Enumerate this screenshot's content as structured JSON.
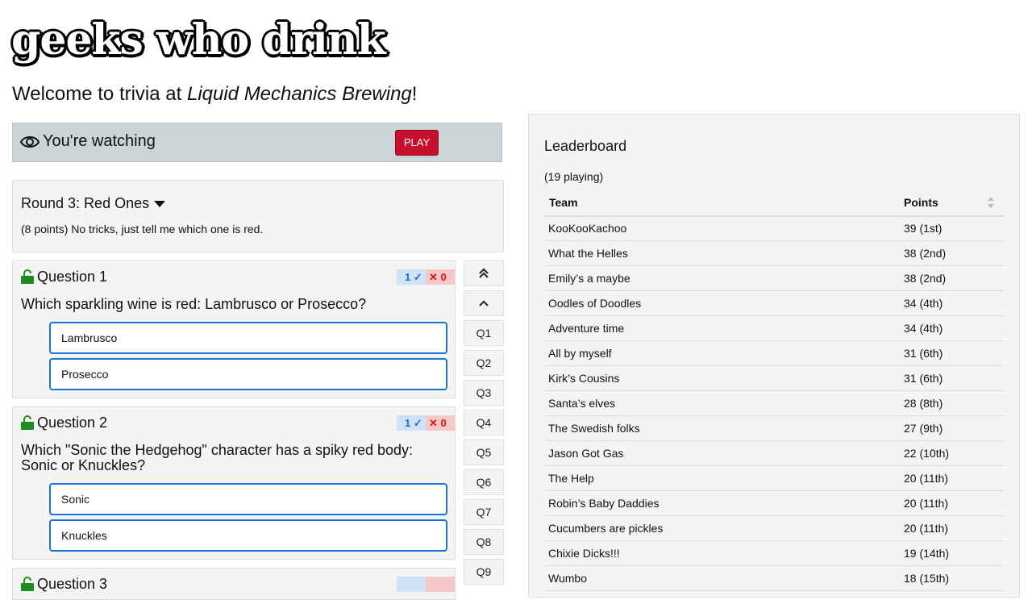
{
  "logo_text": "geeks who drink",
  "welcome": {
    "prefix": "Welcome to trivia at ",
    "venue": "Liquid Mechanics Brewing",
    "suffix": "!"
  },
  "watching": {
    "text": "You're watching",
    "play_label": "PLAY"
  },
  "round": {
    "title": "Round 3: Red Ones",
    "description": "(8 points) No tricks, just tell me which one is red."
  },
  "questions": [
    {
      "title": "Question 1",
      "text": "Which sparkling wine is red: Lambrusco or Prosecco?",
      "right": "1",
      "wrong": "0",
      "answers": [
        "Lambrusco",
        "Prosecco"
      ]
    },
    {
      "title": "Question 2",
      "text": "Which \"Sonic the Hedgehog\" character has a spiky red body: Sonic or Knuckles?",
      "right": "1",
      "wrong": "0",
      "answers": [
        "Sonic",
        "Knuckles"
      ]
    },
    {
      "title": "Question 3"
    }
  ],
  "nav": {
    "top": "⌃⌃",
    "up": "⌃",
    "items": [
      "Q1",
      "Q2",
      "Q3",
      "Q4",
      "Q5",
      "Q6",
      "Q7",
      "Q8",
      "Q9"
    ]
  },
  "leaderboard": {
    "title": "Leaderboard",
    "count": "(19 playing)",
    "col_team": "Team",
    "col_points": "Points",
    "rows": [
      {
        "team": "KooKooKachoo",
        "points": "39 (1st)"
      },
      {
        "team": "What the Helles",
        "points": "38 (2nd)"
      },
      {
        "team": "Emily’s a maybe",
        "points": "38 (2nd)"
      },
      {
        "team": "Oodles of Doodles",
        "points": "34 (4th)"
      },
      {
        "team": "Adventure time",
        "points": "34 (4th)"
      },
      {
        "team": "All by myself",
        "points": "31 (6th)"
      },
      {
        "team": "Kirk’s Cousins",
        "points": "31 (6th)"
      },
      {
        "team": "Santa’s elves",
        "points": "28 (8th)"
      },
      {
        "team": "The Swedish folks",
        "points": "27 (9th)"
      },
      {
        "team": "Jason Got Gas",
        "points": "22 (10th)"
      },
      {
        "team": "The Help",
        "points": "20 (11th)"
      },
      {
        "team": "Robin’s Baby Daddies",
        "points": "20 (11th)"
      },
      {
        "team": "Cucumbers are pickles",
        "points": "20 (11th)"
      },
      {
        "team": "Chixie Dicks!!!",
        "points": "19 (14th)"
      },
      {
        "team": "Wumbo",
        "points": "18 (15th)"
      }
    ]
  },
  "colors": {
    "accent": "#1a73d6",
    "play": "#c8102e",
    "lock": "#1f8a1f",
    "watching_bg": "#c9d5d6"
  }
}
